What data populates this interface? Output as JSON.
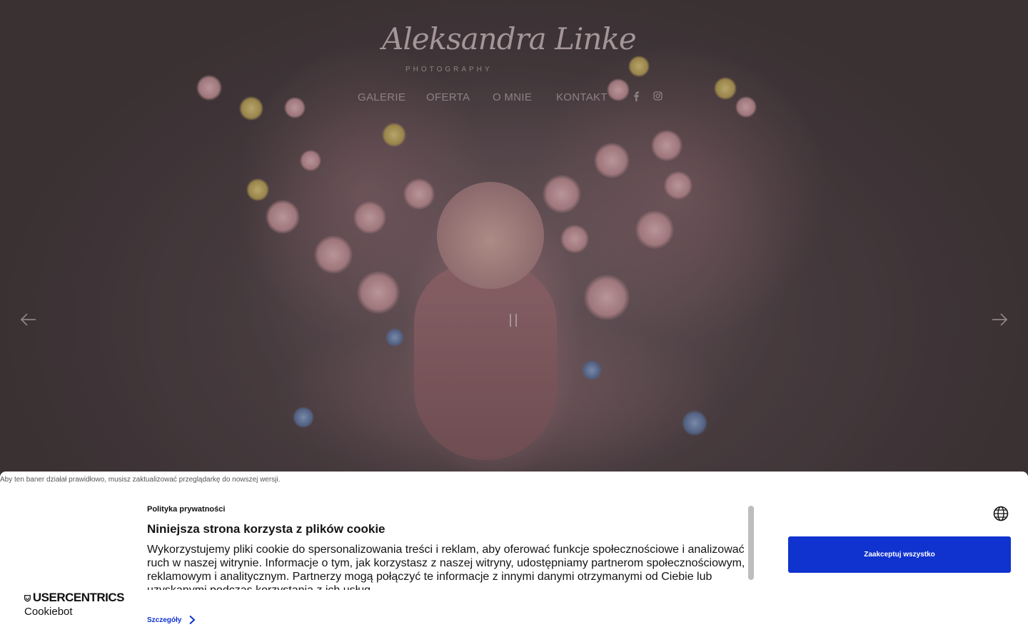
{
  "header": {
    "logo_script": "Aleksandra Linke",
    "logo_sub": "PHOTOGRAPHY",
    "nav": [
      "GALERIE",
      "OFERTA",
      "O MNIE",
      "KONTAKT"
    ],
    "social": [
      "facebook-icon",
      "instagram-icon"
    ]
  },
  "slider": {
    "prev_icon": "arrow-left-icon",
    "next_icon": "arrow-right-icon",
    "pause_icon": "pause-icon"
  },
  "cookie_banner": {
    "browser_note": "Aby ten baner działał prawidłowo, musisz zaktualizować przeglądarkę do nowszej wersji.",
    "brand_top": "USERCENTRICS",
    "brand_bottom": "Cookiebot",
    "policy_label": "Polityka prywatności",
    "title": "Niniejsza strona korzysta z plików cookie",
    "body": "Wykorzystujemy pliki cookie do spersonalizowania treści i reklam, aby oferować funkcje społecznościowe i analizować ruch w naszej witrynie. Informacje o tym, jak korzystasz z naszej witryny, udostępniamy partnerom społecznościowym, reklamowym i analitycznym. Partnerzy mogą połączyć te informacje z innymi danymi otrzymanymi od Ciebie lub uzyskanymi podczas korzystania z ich usług.",
    "details_label": "Szczegóły",
    "accept_label": "Zaakceptuj wszystko",
    "accent_color": "#1032cf"
  }
}
